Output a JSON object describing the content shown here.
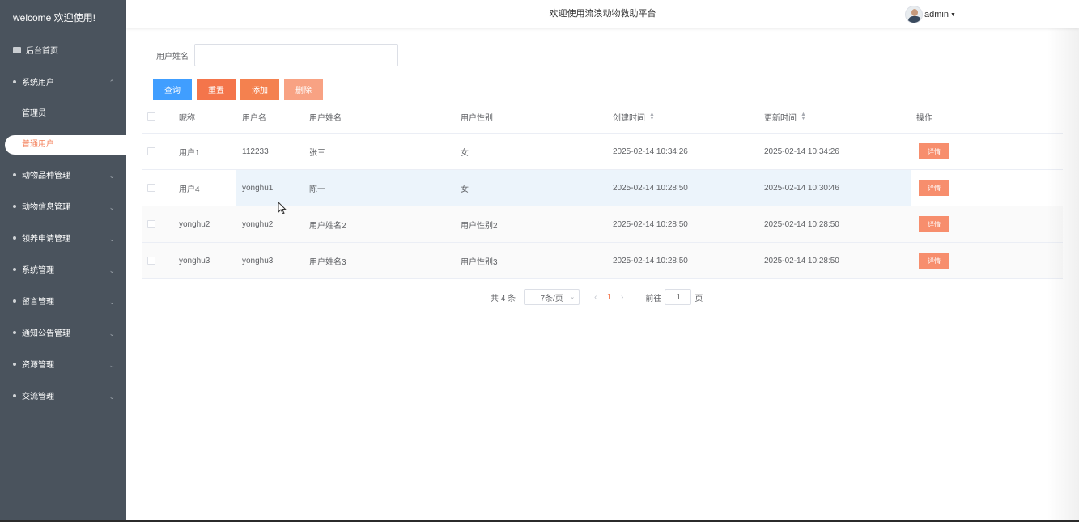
{
  "sidebar": {
    "welcome": "welcome 欢迎使用!",
    "home": "后台首页",
    "system_users": "系统用户",
    "sub_admin": "管理员",
    "sub_users": "普通用户",
    "menus": [
      "动物品种管理",
      "动物信息管理",
      "领养申请管理",
      "系统管理",
      "留言管理",
      "通知公告管理",
      "资源管理",
      "交流管理"
    ]
  },
  "header": {
    "title": "欢迎使用流浪动物救助平台",
    "user": "admin"
  },
  "search": {
    "label": "用户姓名",
    "value": "",
    "placeholder": ""
  },
  "buttons": {
    "query": "查询",
    "reset": "重置",
    "add": "添加",
    "delete": "删除"
  },
  "table": {
    "columns": [
      "昵称",
      "用户名",
      "用户姓名",
      "用户性别",
      "创建时间",
      "更新时间",
      "操作"
    ],
    "detail_label": "详情",
    "rows": [
      [
        "用户1",
        "112233",
        "张三",
        "女",
        "2025-02-14 10:34:26",
        "2025-02-14 10:34:26"
      ],
      [
        "用户4",
        "yonghu1",
        "陈一",
        "女",
        "2025-02-14 10:28:50",
        "2025-02-14 10:30:46"
      ],
      [
        "yonghu2",
        "yonghu2",
        "用户姓名2",
        "用户性别2",
        "2025-02-14 10:28:50",
        "2025-02-14 10:28:50"
      ],
      [
        "yonghu3",
        "yonghu3",
        "用户姓名3",
        "用户性别3",
        "2025-02-14 10:28:50",
        "2025-02-14 10:28:50"
      ]
    ]
  },
  "pagination": {
    "total": "共 4 条",
    "page_size": "7条/页",
    "current_page": "1",
    "goto_label": "前往",
    "goto_value": "1",
    "page_suffix": "页"
  },
  "colors": {
    "sidebar_bg": "#4a535d",
    "primary": "#409eff",
    "accent": "#f4754b"
  }
}
